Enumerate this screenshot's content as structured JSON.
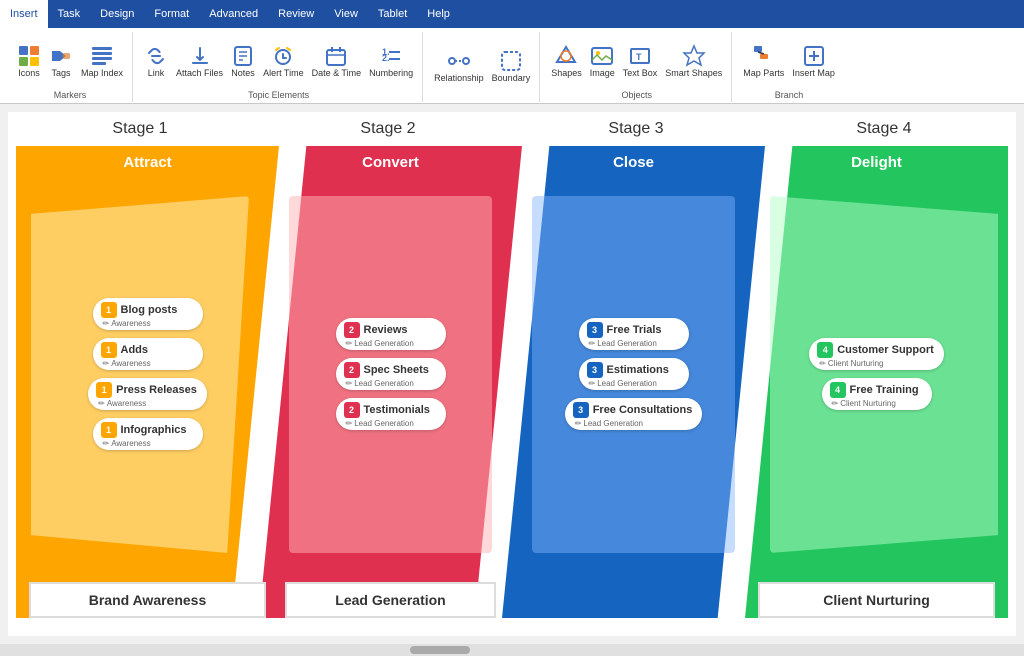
{
  "tabs": [
    "Insert",
    "Task",
    "Design",
    "Format",
    "Advanced",
    "Review",
    "View",
    "Tablet",
    "Help"
  ],
  "active_tab": "Insert",
  "ribbon": {
    "groups": [
      {
        "label": "Markers",
        "items": [
          {
            "icon": "🖼",
            "label": "Icons"
          },
          {
            "icon": "🏷",
            "label": "Tags"
          },
          {
            "icon": "📑",
            "label": "Map Index"
          }
        ]
      },
      {
        "label": "Topic Elements",
        "items": [
          {
            "icon": "🔗",
            "label": "Link"
          },
          {
            "icon": "📎",
            "label": "Attach Files"
          },
          {
            "icon": "📝",
            "label": "Notes"
          },
          {
            "icon": "🔔",
            "label": "Alert Time"
          },
          {
            "icon": "📅",
            "label": "Date & Time"
          },
          {
            "icon": "🔢",
            "label": "Numbering"
          }
        ]
      },
      {
        "label": "",
        "items": [
          {
            "icon": "↔",
            "label": "Relationship"
          },
          {
            "icon": "⬜",
            "label": "Boundary"
          }
        ]
      },
      {
        "label": "Objects",
        "items": [
          {
            "icon": "⬡",
            "label": "Shapes"
          },
          {
            "icon": "🖼",
            "label": "Image"
          },
          {
            "icon": "🔤",
            "label": "Text Box"
          },
          {
            "icon": "⭐",
            "label": "Smart Shapes"
          }
        ]
      },
      {
        "label": "Branch",
        "items": [
          {
            "icon": "🗺",
            "label": "Map Parts"
          },
          {
            "icon": "➕",
            "label": "Insert Map"
          }
        ]
      }
    ]
  },
  "stages": [
    {
      "stage_label": "Stage 1",
      "title": "Attract",
      "color": "#FFA500",
      "bottom_label": "Brand Awareness",
      "topics": [
        {
          "num": "1",
          "name": "Blog posts",
          "tag": "Awareness",
          "color": "yellow"
        },
        {
          "num": "1",
          "name": "Adds",
          "tag": "Awareness",
          "color": "yellow"
        },
        {
          "num": "1",
          "name": "Press Releases",
          "tag": "Awareness",
          "color": "yellow"
        },
        {
          "num": "1",
          "name": "Infographics",
          "tag": "Awareness",
          "color": "yellow"
        }
      ]
    },
    {
      "stage_label": "Stage 2",
      "title": "Convert",
      "color": "#e03050",
      "bottom_label": "Lead Generation",
      "topics": [
        {
          "num": "2",
          "name": "Reviews",
          "tag": "Lead Generation",
          "color": "red"
        },
        {
          "num": "2",
          "name": "Spec Sheets",
          "tag": "Lead Generation",
          "color": "red"
        },
        {
          "num": "2",
          "name": "Testimonials",
          "tag": "Lead Generation",
          "color": "red"
        }
      ]
    },
    {
      "stage_label": "Stage 3",
      "title": "Close",
      "color": "#1565C0",
      "bottom_label": "",
      "topics": [
        {
          "num": "3",
          "name": "Free Trials",
          "tag": "Lead Generation",
          "color": "blue"
        },
        {
          "num": "3",
          "name": "Estimations",
          "tag": "Lead Generation",
          "color": "blue"
        },
        {
          "num": "3",
          "name": "Free Consultations",
          "tag": "Lead Generation",
          "color": "blue"
        }
      ]
    },
    {
      "stage_label": "Stage 4",
      "title": "Delight",
      "color": "#22c55e",
      "bottom_label": "Client Nurturing",
      "topics": [
        {
          "num": "4",
          "name": "Customer Support",
          "tag": "Client Nurturing",
          "color": "green"
        },
        {
          "num": "4",
          "name": "Free Training",
          "tag": "Client Nurturing",
          "color": "green"
        }
      ]
    }
  ]
}
